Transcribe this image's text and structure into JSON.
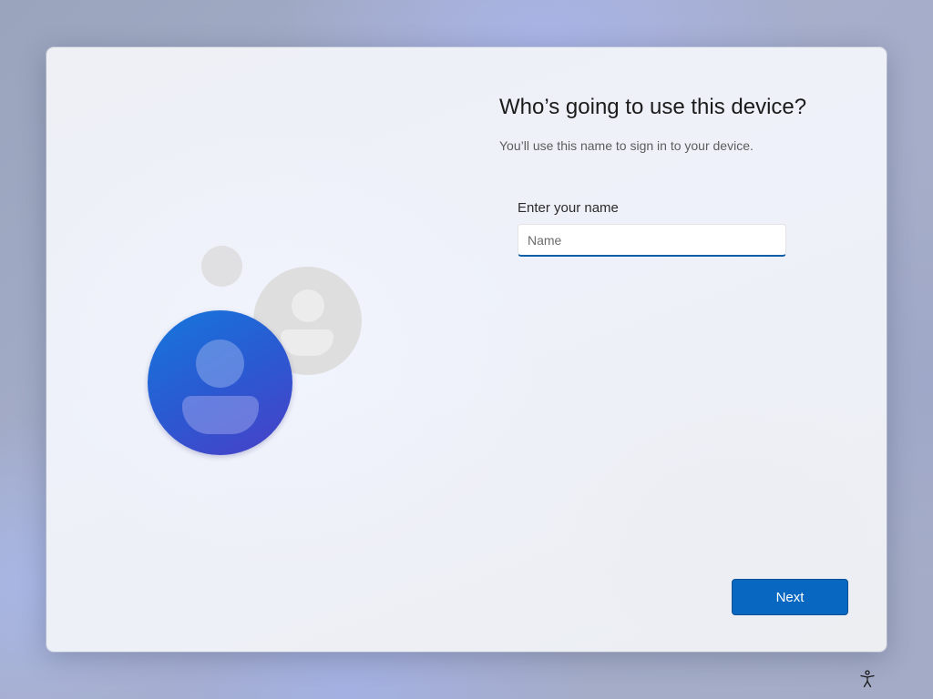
{
  "setup": {
    "title": "Who’s going to use this device?",
    "subtitle": "You’ll use this name to sign in to your device.",
    "name_field": {
      "label": "Enter your name",
      "placeholder": "Name",
      "value": ""
    },
    "next_label": "Next"
  },
  "icons": {
    "illustration": "user-accounts-illustration",
    "accessibility": "accessibility-icon"
  },
  "colors": {
    "accent": "#0867c0",
    "input_focus_underline": "#0a5ea8",
    "avatar_blue": "#2a5ad2"
  }
}
